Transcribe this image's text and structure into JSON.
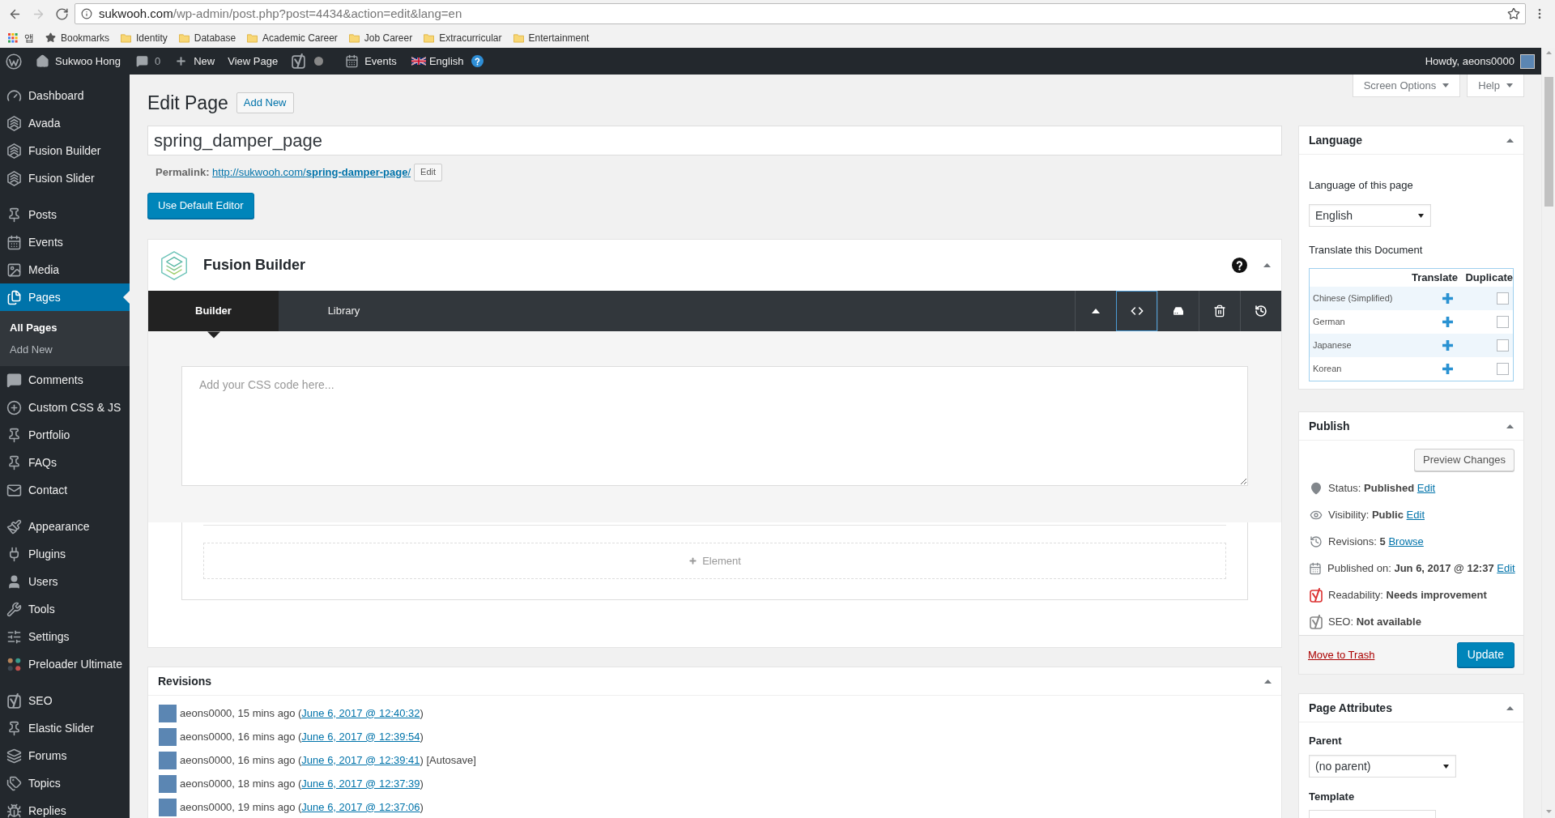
{
  "browser": {
    "nav": [
      {
        "kind": "back",
        "disabled": false
      },
      {
        "kind": "forward",
        "disabled": true
      },
      {
        "kind": "reload",
        "disabled": false
      }
    ],
    "url_domain": "sukwooh.com",
    "url_path": "/wp-admin/post.php?post=4434&action=edit&lang=en"
  },
  "bookmarks_bar": {
    "apps": "앱",
    "items": [
      {
        "kind": "star",
        "label": "Bookmarks"
      },
      {
        "kind": "folder",
        "label": "Identity"
      },
      {
        "kind": "folder",
        "label": "Database"
      },
      {
        "kind": "folder",
        "label": "Academic Career"
      },
      {
        "kind": "folder",
        "label": "Job Career"
      },
      {
        "kind": "folder",
        "label": "Extracurricular"
      },
      {
        "kind": "folder",
        "label": "Entertainment"
      }
    ]
  },
  "admin_bar": {
    "site": "Sukwoo Hong",
    "comments": "0",
    "new": "New",
    "view_page": "View Page",
    "events": "Events",
    "language": "English",
    "greeting": "Howdy, aeons0000"
  },
  "sidebar": {
    "groups": [
      {
        "items": [
          {
            "label": "Dashboard",
            "selected": false
          },
          {
            "label": "Avada",
            "selected": false
          },
          {
            "label": "Fusion Builder",
            "selected": false
          },
          {
            "label": "Fusion Slider",
            "selected": false
          }
        ]
      },
      {
        "items": [
          {
            "label": "Posts",
            "selected": false
          },
          {
            "label": "Events",
            "selected": false
          },
          {
            "label": "Media",
            "selected": false
          },
          {
            "label": "Pages",
            "selected": true,
            "children": [
              {
                "label": "All Pages",
                "selected": true
              },
              {
                "label": "Add New",
                "selected": false
              }
            ]
          },
          {
            "label": "Comments",
            "selected": false
          },
          {
            "label": "Custom CSS & JS",
            "selected": false
          },
          {
            "label": "Portfolio",
            "selected": false
          },
          {
            "label": "FAQs",
            "selected": false
          },
          {
            "label": "Contact",
            "selected": false
          }
        ]
      },
      {
        "items": [
          {
            "label": "Appearance",
            "selected": false
          },
          {
            "label": "Plugins",
            "selected": false
          },
          {
            "label": "Users",
            "selected": false
          },
          {
            "label": "Tools",
            "selected": false
          },
          {
            "label": "Settings",
            "selected": false
          },
          {
            "label": "Preloader Ultimate",
            "selected": false
          }
        ]
      },
      {
        "items": [
          {
            "label": "SEO",
            "selected": false
          },
          {
            "label": "Elastic Slider",
            "selected": false
          },
          {
            "label": "Forums",
            "selected": false
          },
          {
            "label": "Topics",
            "selected": false
          },
          {
            "label": "Replies",
            "selected": false
          }
        ]
      }
    ]
  },
  "screen_meta": [
    {
      "label": "Screen Options"
    },
    {
      "label": "Help"
    }
  ],
  "page_header": {
    "title": "Edit Page",
    "add_new": "Add New"
  },
  "editor": {
    "title": "spring_damper_page",
    "permalink_label": "Permalink:",
    "permalink": "http://sukwooh.com/**spring-damper-page**/",
    "permalink_edit": "Edit",
    "default_editor": "Use Default Editor"
  },
  "fusion_builder": {
    "title": "Fusion Builder",
    "tabs": [
      {
        "label": "Builder",
        "selected": true
      },
      {
        "label": "Library",
        "selected": false
      }
    ],
    "tools": [
      {
        "kind": "collapse",
        "selected": false
      },
      {
        "kind": "code",
        "selected": true
      },
      {
        "kind": "save",
        "selected": false
      },
      {
        "kind": "delete",
        "selected": false
      },
      {
        "kind": "history",
        "selected": false
      }
    ],
    "css_placeholder": "Add your CSS code here...",
    "add_element": "Element"
  },
  "revisions": {
    "title": "Revisions",
    "rows": [
      {
        "before": "aeons0000, 15 mins ago (",
        "link": "June 6, 2017 @ 12:40:32",
        "after": ")"
      },
      {
        "before": "aeons0000, 16 mins ago (",
        "link": "June 6, 2017 @ 12:39:54",
        "after": ")"
      },
      {
        "before": "aeons0000, 16 mins ago (",
        "link": "June 6, 2017 @ 12:39:41",
        "after": ") [Autosave]"
      },
      {
        "before": "aeons0000, 18 mins ago (",
        "link": "June 6, 2017 @ 12:37:39",
        "after": ")"
      },
      {
        "before": "aeons0000, 19 mins ago (",
        "link": "June 6, 2017 @ 12:37:06",
        "after": ")"
      }
    ]
  },
  "language": {
    "title": "Language",
    "page_language_label": "Language of this page",
    "page_language": "English",
    "translate_label": "Translate this Document",
    "columns": [
      "Translate",
      "Duplicate"
    ],
    "rows": [
      {
        "name": "Chinese (Simplified)",
        "duplicate": false
      },
      {
        "name": "German",
        "duplicate": false
      },
      {
        "name": "Japanese",
        "duplicate": false
      },
      {
        "name": "Korean",
        "duplicate": false
      }
    ]
  },
  "publish": {
    "title": "Publish",
    "preview": "Preview Changes",
    "fields": [
      {
        "kind": "status",
        "text": "Status: **Published**",
        "link": "Edit"
      },
      {
        "kind": "visibility",
        "text": "Visibility: **Public**",
        "link": "Edit"
      },
      {
        "kind": "revisions",
        "text": "Revisions: **5**",
        "link": "Browse"
      },
      {
        "kind": "date",
        "text": "Published on: **Jun 6, 2017 @ 12:37**",
        "link": "Edit"
      },
      {
        "kind": "readability",
        "text": "Readability: **Needs improvement**"
      },
      {
        "kind": "seo",
        "text": "SEO: **Not available**"
      }
    ],
    "trash": "Move to Trash",
    "update": "Update"
  },
  "page_attributes": {
    "title": "Page Attributes",
    "parent_label": "Parent",
    "parent": "(no parent)",
    "template_label": "Template"
  }
}
